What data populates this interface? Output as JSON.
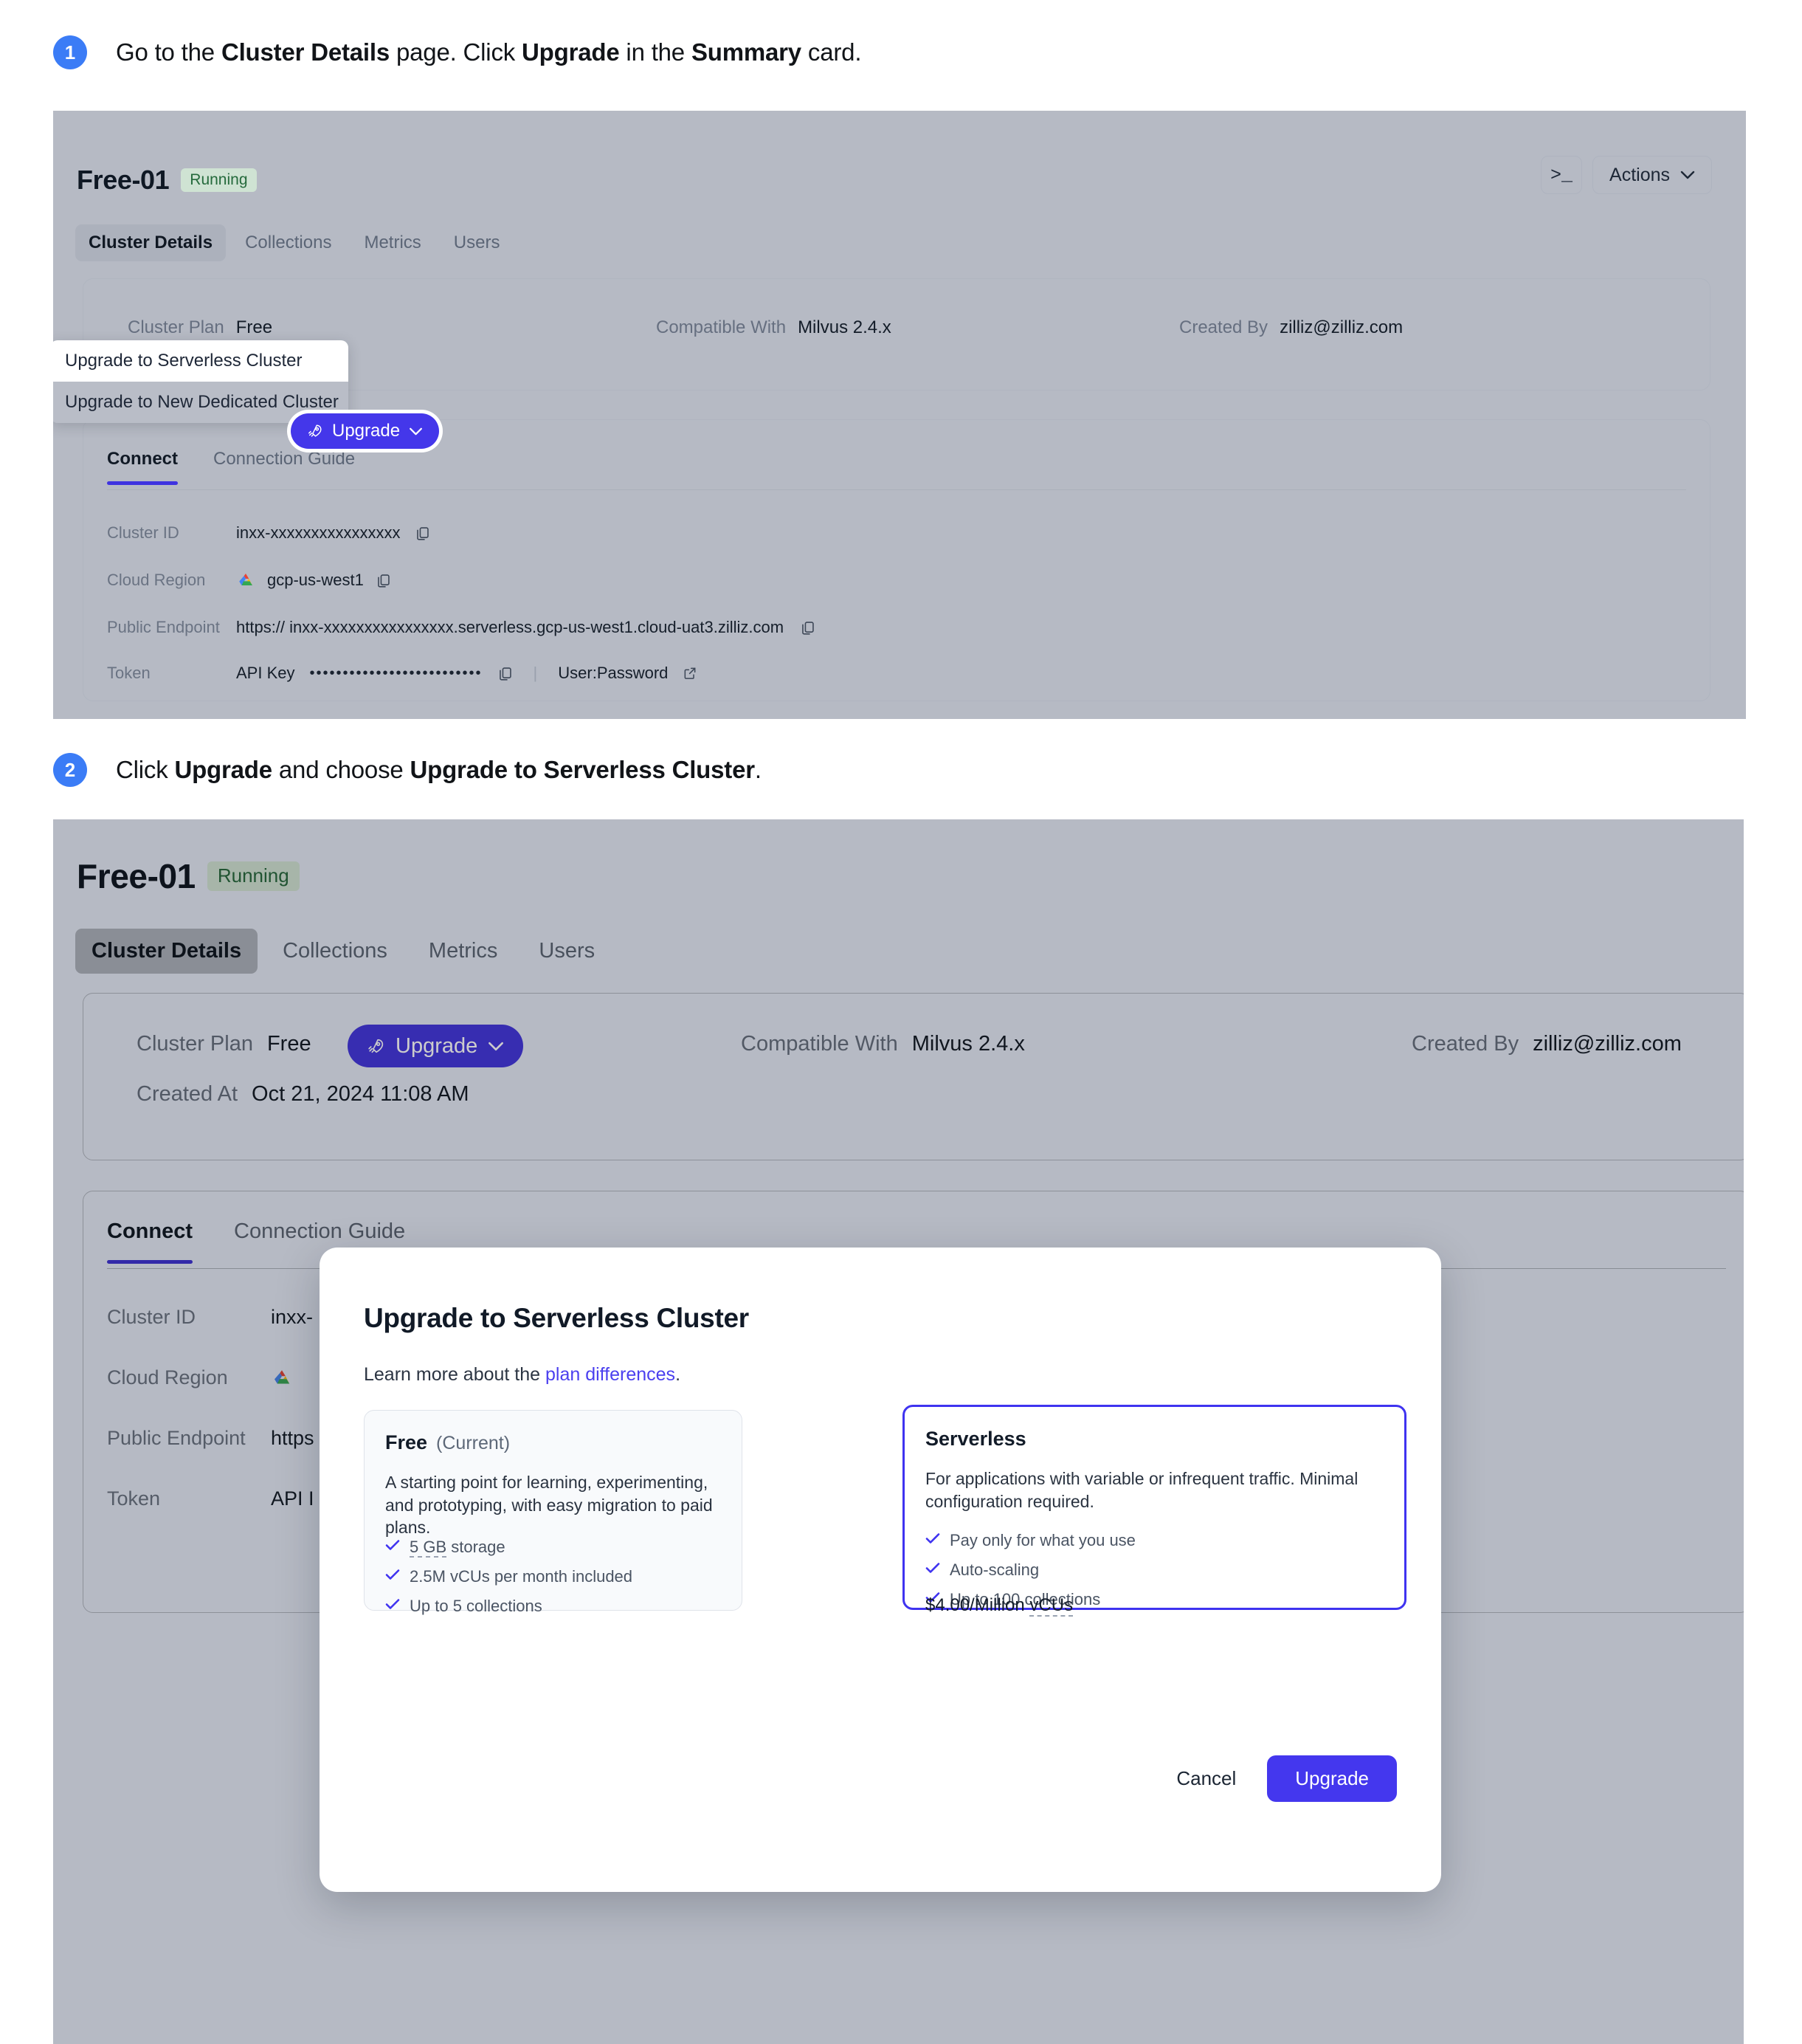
{
  "steps": [
    {
      "number": "1",
      "parts": [
        {
          "t": "Go to the ",
          "b": false
        },
        {
          "t": "Cluster Details",
          "b": true
        },
        {
          "t": " page. Click ",
          "b": false
        },
        {
          "t": "Upgrade",
          "b": true
        },
        {
          "t": " in the ",
          "b": false
        },
        {
          "t": "Summary",
          "b": true
        },
        {
          "t": " card.",
          "b": false
        }
      ]
    },
    {
      "number": "2",
      "parts": [
        {
          "t": "Click ",
          "b": false
        },
        {
          "t": "Upgrade",
          "b": true
        },
        {
          "t": " and choose ",
          "b": false
        },
        {
          "t": "Upgrade to Serverless Cluster",
          "b": true
        },
        {
          "t": ".",
          "b": false
        }
      ]
    }
  ],
  "panel1": {
    "cluster_name": "Free-01",
    "status": "Running",
    "terminal_icon": "terminal-icon",
    "actions_label": "Actions",
    "tabs": [
      {
        "label": "Cluster Details",
        "active": true
      },
      {
        "label": "Collections",
        "active": false
      },
      {
        "label": "Metrics",
        "active": false
      },
      {
        "label": "Users",
        "active": false
      }
    ],
    "summary": {
      "cluster_plan_label": "Cluster Plan",
      "cluster_plan_value": "Free",
      "upgrade_label": "Upgrade",
      "compatible_label": "Compatible With",
      "compatible_value": "Milvus 2.4.x",
      "created_by_label": "Created By",
      "created_by_value": "zilliz@zilliz.com"
    },
    "dropdown": {
      "items": [
        {
          "label": "Upgrade to Serverless Cluster",
          "highlighted": true
        },
        {
          "label": "Upgrade to New Dedicated Cluster",
          "highlighted": false
        }
      ]
    },
    "connect": {
      "subtabs": [
        {
          "label": "Connect",
          "active": true
        },
        {
          "label": "Connection Guide",
          "active": false
        }
      ],
      "rows": [
        {
          "label": "Cluster ID",
          "value": "inxx-xxxxxxxxxxxxxxxx"
        },
        {
          "label": "Cloud Region",
          "value": "gcp-us-west1"
        },
        {
          "label": "Public Endpoint",
          "value": "https:// inxx-xxxxxxxxxxxxxxxx.serverless.gcp-us-west1.cloud-uat3.zilliz.com"
        },
        {
          "label": "Token",
          "value": "API Key"
        }
      ],
      "token_dots": "••••••••••••••••••••••••••",
      "token_user_password": "User:Password"
    }
  },
  "panel2": {
    "cluster_name": "Free-01",
    "status": "Running",
    "tabs": [
      {
        "label": "Cluster Details",
        "active": true
      },
      {
        "label": "Collections",
        "active": false
      },
      {
        "label": "Metrics",
        "active": false
      },
      {
        "label": "Users",
        "active": false
      }
    ],
    "summary": {
      "cluster_plan_label": "Cluster Plan",
      "cluster_plan_value": "Free",
      "upgrade_label": "Upgrade",
      "compatible_label": "Compatible With",
      "compatible_value": "Milvus 2.4.x",
      "created_by_label": "Created By",
      "created_by_value": "zilliz@zilliz.com",
      "created_at_label": "Created At",
      "created_at_value": "Oct 21, 2024 11:08 AM"
    },
    "connect": {
      "subtabs": [
        {
          "label": "Connect",
          "active": true
        },
        {
          "label": "Connection Guide",
          "active": false
        }
      ],
      "rows": [
        {
          "label": "Cluster ID",
          "value": "inxx-"
        },
        {
          "label": "Cloud Region",
          "value": ""
        },
        {
          "label": "Public Endpoint",
          "value": "https"
        },
        {
          "label": "Token",
          "value": "API I"
        }
      ]
    }
  },
  "modal": {
    "title": "Upgrade to Serverless Cluster",
    "subtitle_pre": "Learn more about the ",
    "subtitle_link": "plan differences",
    "subtitle_post": ".",
    "plans": [
      {
        "name": "Free",
        "tag": "(Current)",
        "description": "A starting point for learning, experimenting, and prototyping, with easy migration to paid plans.",
        "features": [
          {
            "dashed": "5 GB",
            "rest": " storage"
          },
          {
            "dashed": "",
            "rest": "2.5M vCUs per month included"
          },
          {
            "dashed": "",
            "rest": "Up to 5 collections"
          }
        ],
        "price": "",
        "selected": false
      },
      {
        "name": "Serverless",
        "tag": "",
        "description": "For applications with variable or infrequent traffic. Minimal configuration required.",
        "features": [
          {
            "dashed": "",
            "rest": "Pay only for what you use"
          },
          {
            "dashed": "",
            "rest": "Auto-scaling"
          },
          {
            "dashed": "",
            "rest": "Up to 100 collections"
          }
        ],
        "price_pre": "$4.00/Million ",
        "price_dashed": "vCUs",
        "selected": true
      }
    ],
    "cancel_label": "Cancel",
    "upgrade_label": "Upgrade"
  },
  "colors": {
    "accent_blue": "#4437ea",
    "step_badge": "#3b7cf6",
    "panel_bg": "#b6bac4",
    "status_green": "#256a3c",
    "link": "#4b40ef"
  }
}
